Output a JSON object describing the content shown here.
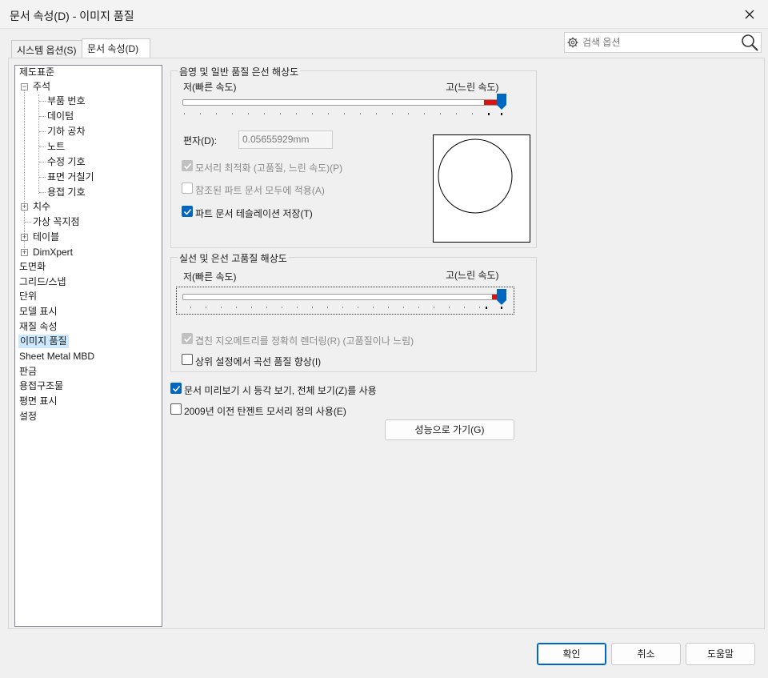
{
  "window": {
    "title": "문서 속성(D) - 이미지 품질"
  },
  "tabs": [
    {
      "label": "시스템 옵션(S)"
    },
    {
      "label": "문서 속성(D)"
    }
  ],
  "search": {
    "placeholder": "검색 옵션"
  },
  "tree": {
    "items": [
      {
        "label": "제도표준"
      },
      {
        "label": "주석"
      },
      {
        "label": "부품 번호"
      },
      {
        "label": "데이텀"
      },
      {
        "label": "기하 공차"
      },
      {
        "label": "노트"
      },
      {
        "label": "수정 기호"
      },
      {
        "label": "표면 거칠기"
      },
      {
        "label": "용접 기호"
      },
      {
        "label": "치수"
      },
      {
        "label": "가상 꼭지점"
      },
      {
        "label": "테이블"
      },
      {
        "label": "DimXpert"
      },
      {
        "label": "도면화"
      },
      {
        "label": "그리드/스냅"
      },
      {
        "label": "단위"
      },
      {
        "label": "모델 표시"
      },
      {
        "label": "재질 속성"
      },
      {
        "label": "이미지 품질"
      },
      {
        "label": "Sheet Metal MBD"
      },
      {
        "label": "판금"
      },
      {
        "label": "용접구조물"
      },
      {
        "label": "평면 표시"
      },
      {
        "label": "설정"
      }
    ],
    "selected": "이미지 품질"
  },
  "shaded_group": {
    "title": "음영 및 일반 품질 은선 해상도",
    "low_label": "저(빠른 속도)",
    "high_label": "고(느린 속도)",
    "slider_value_percent": 100,
    "deviation_label": "편자(D):",
    "deviation_value": "0.05655929mm",
    "optimize_label": "모서리 최적화 (고품질, 느린 속도)(P)",
    "apply_refs_label": "참조된 파트 문서 모두에 적용(A)",
    "save_tess_label": "파트 문서 테슬레이션 저장(T)"
  },
  "wireframe_group": {
    "title": "실선 및 은선 고품질 해상도",
    "low_label": "저(빠른 속도)",
    "high_label": "고(느린 속도)",
    "slider_value_percent": 100,
    "precise_label": "겹친 지오메트리를 정확히 렌더링(R) (고품질이나 느림)",
    "improve_label": "상위 설정에서 곡선 품질 향상(I)"
  },
  "options": {
    "isometric_label": "문서 미리보기 시 등각 보기, 전체 보기(Z)를 사용",
    "pre2009_label": "2009년 이전 탄젠트 모서리 정의 사용(E)",
    "goto_perf_label": "성능으로 가기(G)"
  },
  "buttons": {
    "ok": "확인",
    "cancel": "취소",
    "help": "도움말"
  },
  "colors": {
    "accent": "#0067c0",
    "slider_red": "#e01010",
    "selection": "#cce8ff"
  }
}
